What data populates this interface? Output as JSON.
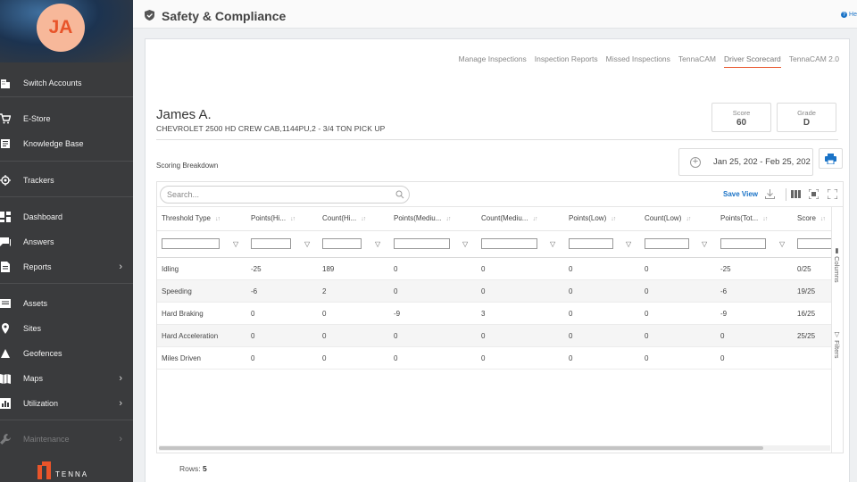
{
  "sidebar": {
    "avatar_initials": "JA",
    "items": [
      {
        "label": "Switch Accounts",
        "icon": "building-icon"
      },
      {
        "label": "E-Store",
        "icon": "cart-icon"
      },
      {
        "label": "Knowledge Base",
        "icon": "book-icon"
      },
      {
        "label": "Trackers",
        "icon": "tracker-icon"
      },
      {
        "label": "Dashboard",
        "icon": "dashboard-icon"
      },
      {
        "label": "Answers",
        "icon": "chat-icon"
      },
      {
        "label": "Reports",
        "icon": "report-icon"
      },
      {
        "label": "Assets",
        "icon": "asset-icon"
      },
      {
        "label": "Sites",
        "icon": "pin-icon"
      },
      {
        "label": "Geofences",
        "icon": "geofence-icon"
      },
      {
        "label": "Maps",
        "icon": "map-icon"
      },
      {
        "label": "Utilization",
        "icon": "chart-icon"
      },
      {
        "label": "Maintenance",
        "icon": "wrench-icon"
      }
    ],
    "brand": "TENNA"
  },
  "header": {
    "title": "Safety & Compliance",
    "help_label": "He"
  },
  "tabs": [
    "Manage Inspections",
    "Inspection Reports",
    "Missed Inspections",
    "TennaCAM",
    "Driver Scorecard",
    "TennaCAM 2.0"
  ],
  "active_tab": "Driver Scorecard",
  "driver": {
    "name": "James A.",
    "vehicle": "CHEVROLET 2500 HD CREW CAB,1144PU,2 - 3/4 TON PICK UP"
  },
  "stats": {
    "score_label": "Score",
    "score_value": "60",
    "grade_label": "Grade",
    "grade_value": "D"
  },
  "section_title": "Scoring Breakdown",
  "date_range": "Jan 25, 202 - Feb 25, 202",
  "grid": {
    "search_placeholder": "Search...",
    "save_view_label": "Save View",
    "columns": [
      "Threshold Type",
      "Points(Hi...",
      "Count(Hi...",
      "Points(Mediu...",
      "Count(Mediu...",
      "Points(Low)",
      "Count(Low)",
      "Points(Tot...",
      "Score"
    ],
    "rows": [
      [
        "Idling",
        "-25",
        "189",
        "0",
        "0",
        "0",
        "0",
        "-25",
        "0/25"
      ],
      [
        "Speeding",
        "-6",
        "2",
        "0",
        "0",
        "0",
        "0",
        "-6",
        "19/25"
      ],
      [
        "Hard Braking",
        "0",
        "0",
        "-9",
        "3",
        "0",
        "0",
        "-9",
        "16/25"
      ],
      [
        "Hard Acceleration",
        "0",
        "0",
        "0",
        "0",
        "0",
        "0",
        "0",
        "25/25"
      ],
      [
        "Miles Driven",
        "0",
        "0",
        "0",
        "0",
        "0",
        "0",
        "0",
        ""
      ]
    ],
    "side_panels": [
      "Columns",
      "Filters"
    ],
    "rows_label": "Rows:",
    "rows_count": "5"
  },
  "colors": {
    "sidebar_bg": "#3a3b3d",
    "accent": "#e8542a",
    "link_blue": "#1a73c7"
  }
}
